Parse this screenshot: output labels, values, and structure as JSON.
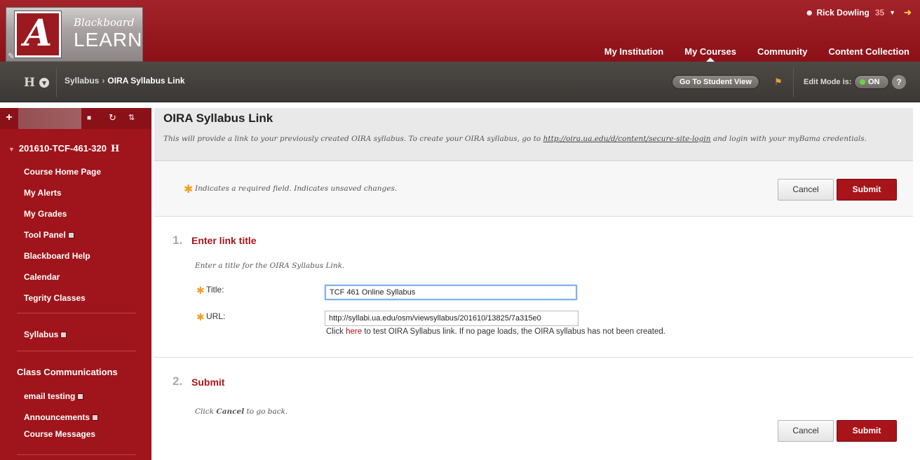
{
  "header": {
    "logo_line1": "Blackboard",
    "logo_line2": "LEARN",
    "logo_letter": "A",
    "user_name": "Rick Dowling",
    "user_count": "35",
    "tabs": [
      {
        "label": "My Institution"
      },
      {
        "label": "My Courses"
      },
      {
        "label": "Community"
      },
      {
        "label": "Content Collection"
      }
    ]
  },
  "breadcrumb_bar": {
    "course_menu_letter": "H",
    "crumbs": [
      "Syllabus",
      "OIRA Syllabus Link"
    ],
    "separator": "›",
    "student_view_label": "Go To Student View",
    "edit_mode_label": "Edit Mode is:",
    "edit_mode_value": "ON",
    "help_label": "?"
  },
  "sidebar": {
    "course_id": "201610-TCF-461-320",
    "course_letter": "H",
    "items": [
      {
        "label": "Course Home Page"
      },
      {
        "label": "My Alerts"
      },
      {
        "label": "My Grades"
      },
      {
        "label": "Tool Panel"
      },
      {
        "label": "Blackboard Help"
      },
      {
        "label": "Calendar"
      },
      {
        "label": "Tegrity Classes"
      },
      {
        "label": "Syllabus"
      },
      {
        "label": "Class Communications"
      },
      {
        "label": "email testing"
      },
      {
        "label": "Announcements"
      },
      {
        "label": "Course Messages"
      }
    ]
  },
  "page": {
    "title": "OIRA Syllabus Link",
    "desc_before": "This will provide a link to your previously created OIRA syllabus. To create your OIRA syllabus, go to ",
    "desc_link": "http://oira.ua.edu/d/content/secure-site-login",
    "desc_after": " and login with your myBama credentials.",
    "required_note": "Indicates a required field. Indicates unsaved changes.",
    "cancel_label": "Cancel",
    "submit_label": "Submit"
  },
  "step1": {
    "number": "1.",
    "title": "Enter link title",
    "instruction": "Enter a title for the OIRA Syllabus Link.",
    "title_label": "Title:",
    "title_value": "TCF 461 Online Syllabus",
    "url_label": "URL:",
    "url_value": "http://syllabi.ua.edu/osm/viewsyllabus/201610/13825/7a315e0",
    "test_before": "Click ",
    "test_link": "here",
    "test_after": " to test OIRA Syllabus link. If no page loads, the OIRA syllabus has not been created."
  },
  "step2": {
    "number": "2.",
    "title": "Submit",
    "instruction_before": "Click ",
    "instruction_bold": "Cancel",
    "instruction_after": " to go back."
  },
  "colors": {
    "brand_red": "#a7141a",
    "header_red": "#9a1a20",
    "required_star": "#f0a020",
    "edit_on_green": "#68d43b"
  }
}
